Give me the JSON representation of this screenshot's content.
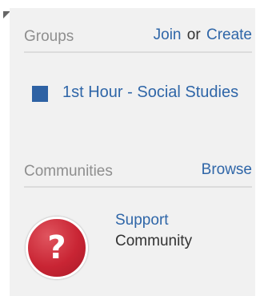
{
  "groups": {
    "title": "Groups",
    "join_label": "Join",
    "or_label": "or",
    "create_label": "Create",
    "items": [
      {
        "label": "1st Hour - Social Studies",
        "color": "#2e62a4"
      }
    ]
  },
  "communities": {
    "title": "Communities",
    "browse_label": "Browse",
    "items": [
      {
        "name_line1": "Support",
        "name_line2": "Community",
        "icon": "question-mark-icon",
        "icon_glyph": "?",
        "icon_color": "#c92534"
      }
    ]
  },
  "colors": {
    "link": "#2f66a8",
    "header_text": "#8e8e8e",
    "panel_background": "#f1f1f1"
  }
}
